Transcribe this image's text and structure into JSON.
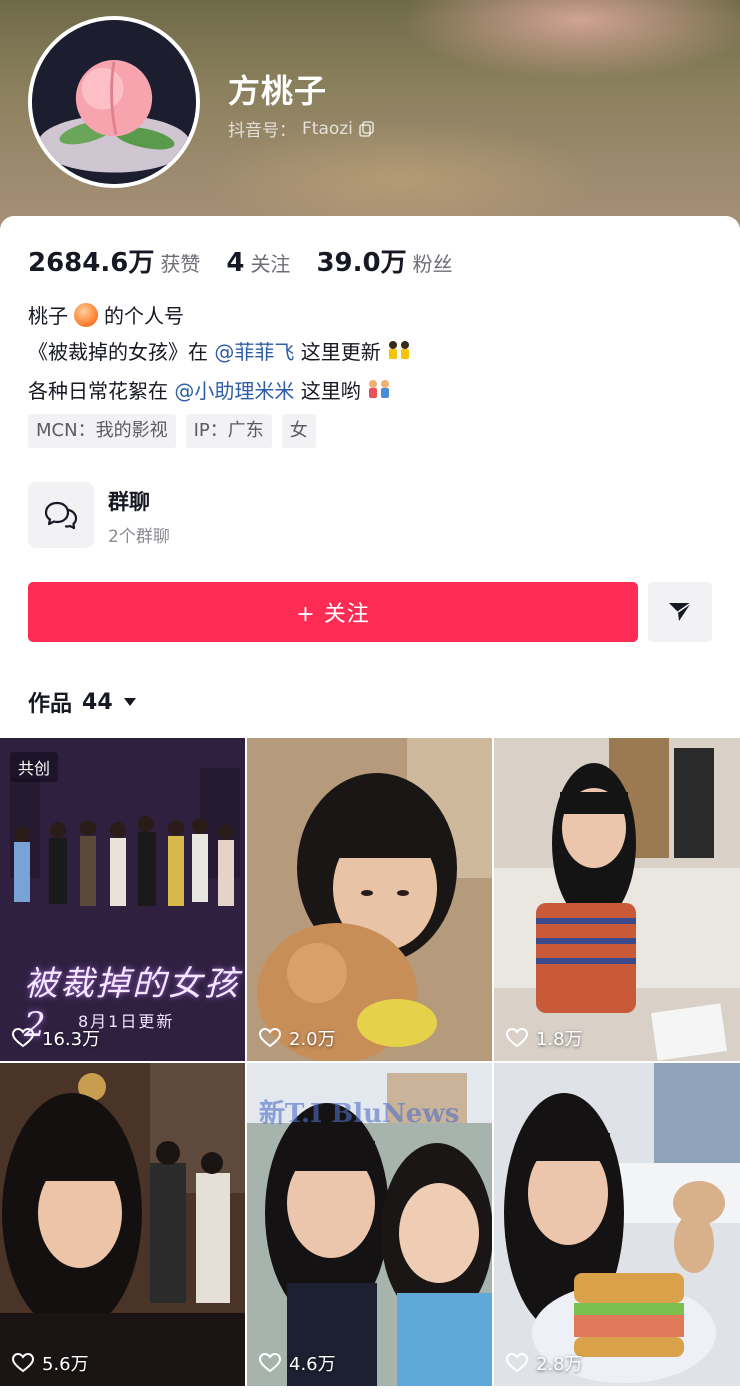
{
  "profile": {
    "name": "方桃子",
    "douyin_id_label": "抖音号：",
    "douyin_id": "Ftaozi"
  },
  "stats": [
    {
      "value": "2684.6万",
      "label": "获赞"
    },
    {
      "value": "4",
      "label": "关注"
    },
    {
      "value": "39.0万",
      "label": "粉丝"
    }
  ],
  "bio": {
    "line1_a": "桃子",
    "line1_b": "的个人号",
    "line2_a": "《被裁掉的女孩》在",
    "line2_mention": "@菲菲飞",
    "line2_b": "这里更新",
    "line3_a": "各种日常花絮在",
    "line3_mention": "@小助理米米",
    "line3_b": "这里哟"
  },
  "tags": [
    "MCN：我的影视",
    "IP：广东",
    "女"
  ],
  "group_chat": {
    "title": "群聊",
    "subtitle": "2个群聊"
  },
  "actions": {
    "follow_label": "+ 关注"
  },
  "works": {
    "label": "作品",
    "count": "44"
  },
  "videos": [
    {
      "likes": "16.3万",
      "badge": "共创",
      "overlay_title": "被裁掉的女孩2",
      "overlay_sub": "8月1日更新"
    },
    {
      "likes": "2.0万"
    },
    {
      "likes": "1.8万"
    },
    {
      "likes": "5.6万"
    },
    {
      "likes": "4.6万",
      "watermark": "新T.I BluNews"
    },
    {
      "likes": "2.8万"
    }
  ],
  "colors": {
    "accent": "#fe2c55",
    "mention": "#2f5ea8"
  }
}
